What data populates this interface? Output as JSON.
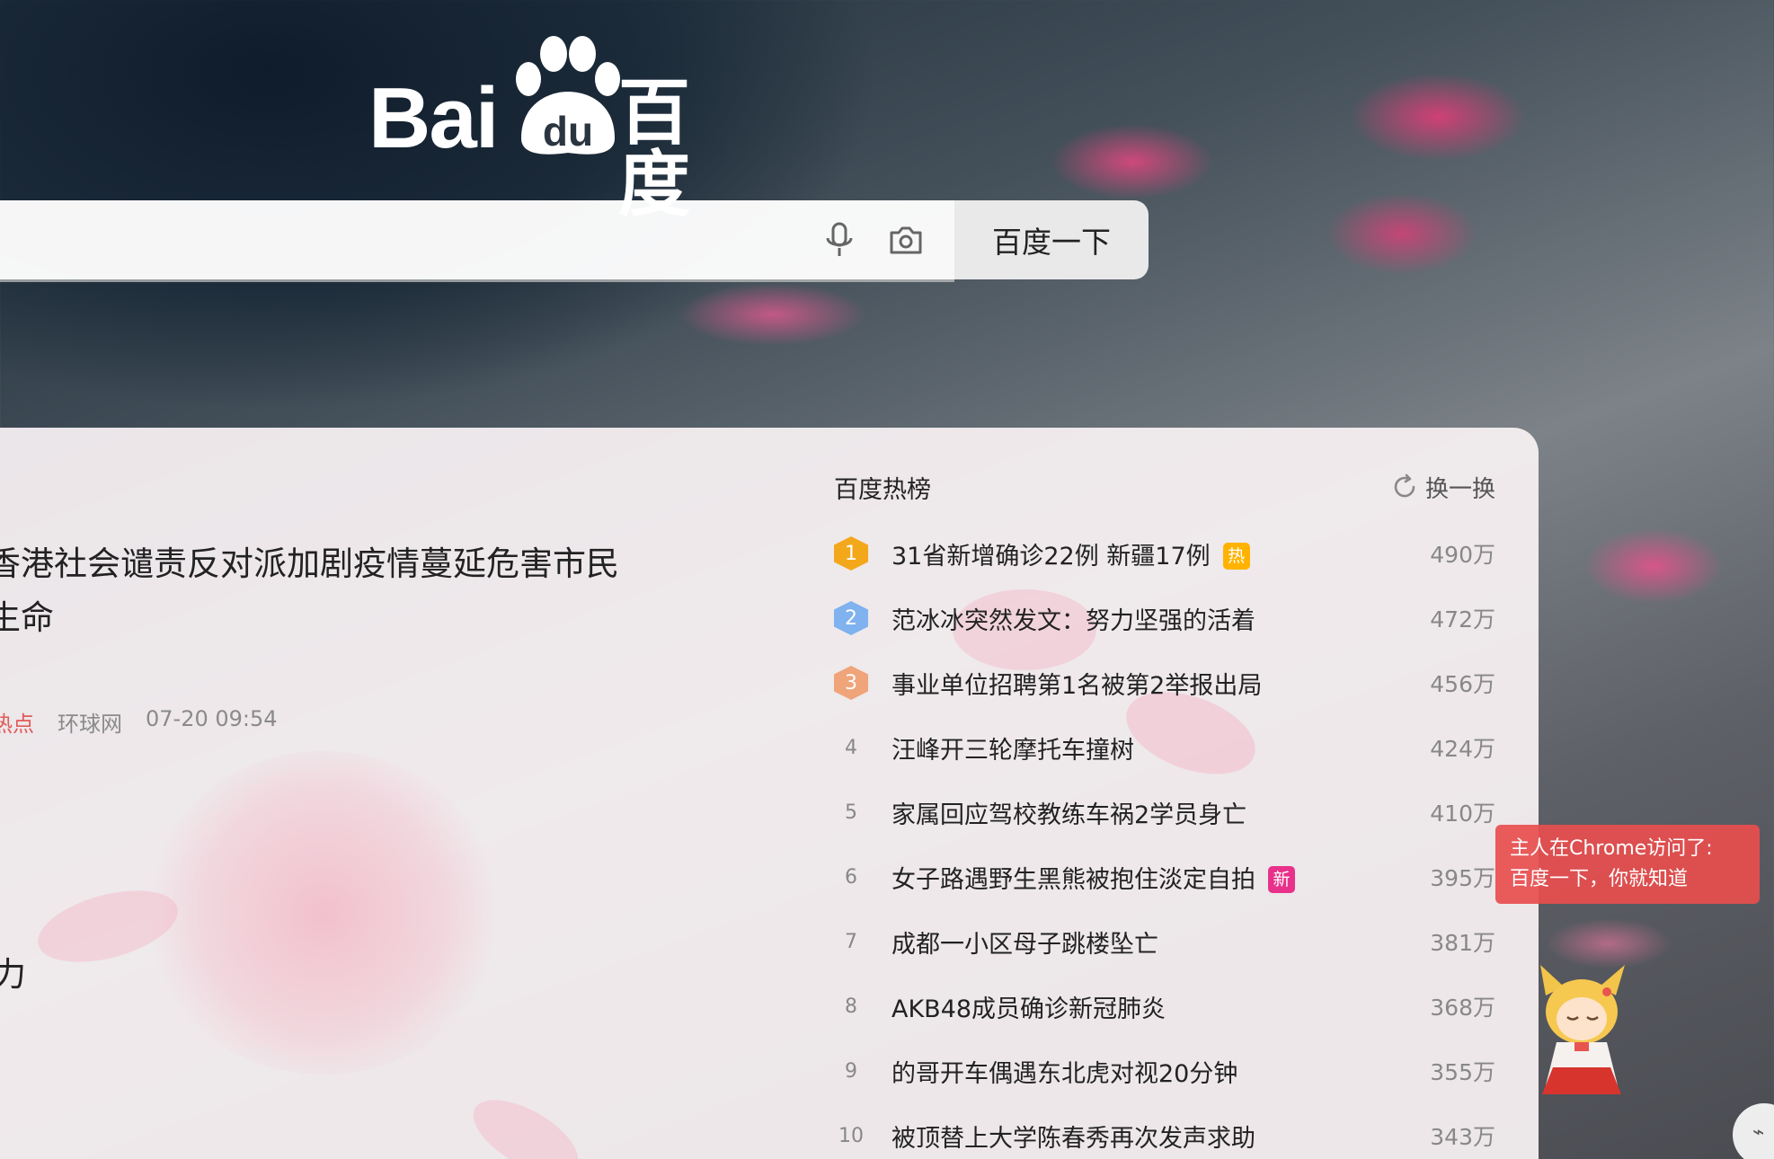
{
  "logo": {
    "latin": "Bai",
    "paw_text": "du",
    "chinese": "百度"
  },
  "search": {
    "value": "",
    "placeholder": "",
    "button_label": "百度一下",
    "icons": [
      "microphone-icon",
      "camera-icon"
    ]
  },
  "news": {
    "title": "香港社会谴责反对派加剧疫情蔓延危害市民生命",
    "meta": {
      "tag": "热点",
      "source": "环球网",
      "time": "07-20 09:54"
    },
    "fragment": "力"
  },
  "hot": {
    "title": "百度热榜",
    "refresh_label": "换一换",
    "items": [
      {
        "rank": "1",
        "text": "31省新增确诊22例 新疆17例",
        "badge": "热",
        "heat": "490万"
      },
      {
        "rank": "2",
        "text": "范冰冰突然发文：努力坚强的活着",
        "badge": "",
        "heat": "472万"
      },
      {
        "rank": "3",
        "text": "事业单位招聘第1名被第2举报出局",
        "badge": "",
        "heat": "456万"
      },
      {
        "rank": "4",
        "text": "汪峰开三轮摩托车撞树",
        "badge": "",
        "heat": "424万"
      },
      {
        "rank": "5",
        "text": "家属回应驾校教练车祸2学员身亡",
        "badge": "",
        "heat": "410万"
      },
      {
        "rank": "6",
        "text": "女子路遇野生黑熊被抱住淡定自拍",
        "badge": "新",
        "heat": "395万"
      },
      {
        "rank": "7",
        "text": "成都一小区母子跳楼坠亡",
        "badge": "",
        "heat": "381万"
      },
      {
        "rank": "8",
        "text": "AKB48成员确诊新冠肺炎",
        "badge": "",
        "heat": "368万"
      },
      {
        "rank": "9",
        "text": "的哥开车偶遇东北虎对视20分钟",
        "badge": "",
        "heat": "355万"
      },
      {
        "rank": "10",
        "text": "被顶替上大学陈春秀再次发声求助",
        "badge": "",
        "heat": "343万"
      }
    ]
  },
  "widget": {
    "line1": "主人在Chrome访问了:",
    "line2": "百度一下，你就知道"
  },
  "colors": {
    "hot_badge": "#ffb300",
    "new_badge": "#e8318a",
    "rank1": "#f3a81c",
    "rank2": "#7fb2ee",
    "rank3": "#f0a47a",
    "toast": "#e84e4e"
  }
}
